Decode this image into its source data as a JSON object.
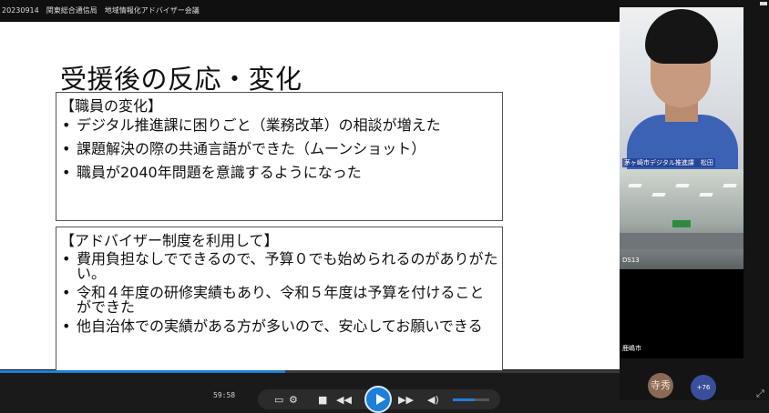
{
  "window": {
    "title": "20230914　関東総合通信局　地域情報化アドバイザー会議"
  },
  "slide": {
    "title": "受援後の反応・変化",
    "box1": {
      "heading": "【職員の変化】",
      "items": [
        "デジタル推進課に困りごと（業務改革）の相談が増えた",
        "課題解決の際の共通言語ができた（ムーンショット）",
        "職員が2040年問題を意識するようになった"
      ]
    },
    "box2": {
      "heading": "【アドバイザー制度を利用して】",
      "items": [
        "費用負担なしでできるので、予算０でも始められるのがありがたい。",
        "令和４年度の研修実績もあり、令和５年度は予算を付けることができた",
        "他自治体での実績がある方が多いので、安心してお願いできる"
      ]
    }
  },
  "player": {
    "timecode": "59:58",
    "progress_fraction": 0.46,
    "volume_fraction": 0.6,
    "accent_color": "#1e7fd8"
  },
  "participants": {
    "speaker_label": "茅ヶ崎市デジタル推進課　松田",
    "room_label": "DS13",
    "city_label": "鹿嶋市",
    "avatar_a": "寺秀",
    "avatar_b": "+76"
  }
}
